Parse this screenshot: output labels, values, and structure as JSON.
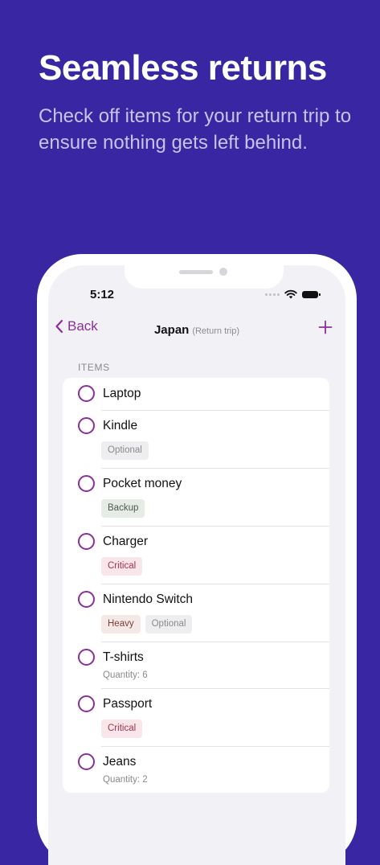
{
  "marketing": {
    "headline": "Seamless returns",
    "subline": "Check off items for your return trip to ensure nothing gets left behind."
  },
  "status_bar": {
    "time": "5:12"
  },
  "nav": {
    "back_label": "Back",
    "title": "Japan",
    "subtitle": "(Return trip)",
    "add_icon": "plus-icon",
    "back_icon": "chevron-left-icon"
  },
  "section_label": "ITEMS",
  "items": [
    {
      "name": "Laptop"
    },
    {
      "name": "Kindle",
      "tags": [
        "Optional"
      ]
    },
    {
      "name": "Pocket money",
      "tags": [
        "Backup"
      ]
    },
    {
      "name": "Charger",
      "tags": [
        "Critical"
      ]
    },
    {
      "name": "Nintendo Switch",
      "tags": [
        "Heavy",
        "Optional"
      ]
    },
    {
      "name": "T-shirts",
      "quantity": "Quantity: 6"
    },
    {
      "name": "Passport",
      "tags": [
        "Critical"
      ]
    },
    {
      "name": "Jeans",
      "quantity": "Quantity: 2"
    }
  ],
  "colors": {
    "background": "#3826a3",
    "accent": "#8a2f9a",
    "critical": "#a3344a"
  }
}
